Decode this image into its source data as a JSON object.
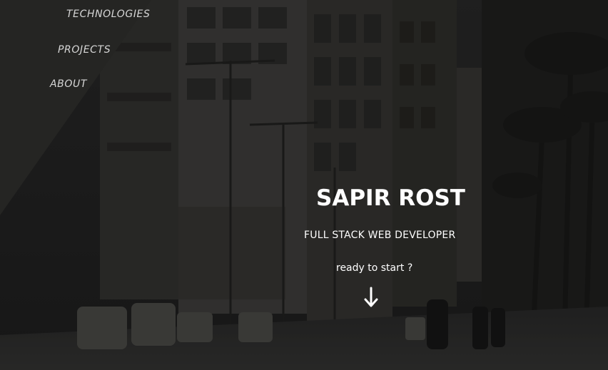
{
  "nav": {
    "items": [
      {
        "label": "TECHNOLOGIES"
      },
      {
        "label": "PROJECTS"
      },
      {
        "label": "ABOUT"
      }
    ]
  },
  "hero": {
    "name": "SAPIR ROST",
    "role": "FULL STACK WEB DEVELOPER",
    "cta": "ready to start ?",
    "background_description_icon": "city-street-photo",
    "scroll_icon": "arrow-down-icon"
  },
  "colors": {
    "sidebar": "#252523",
    "overlay": "#1a1a1a",
    "text": "#ffffff",
    "nav_text": "#d6d6d6"
  }
}
